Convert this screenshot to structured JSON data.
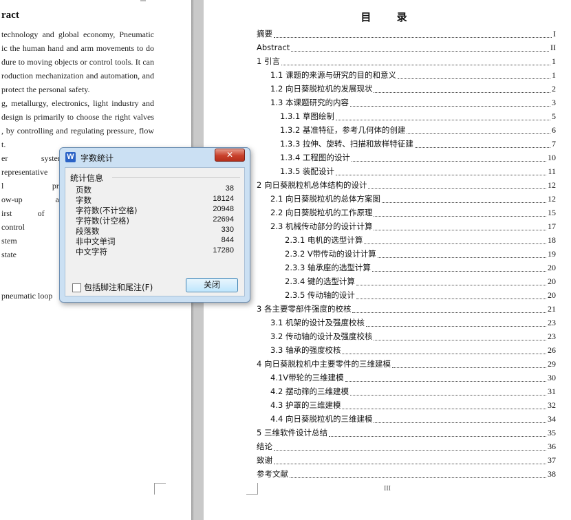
{
  "left_page": {
    "title": "ract",
    "lines": [
      "technology and global economy, Pneumatic",
      "ic the human hand and arm movements to do",
      "dure to moving objects or control tools. It can",
      "roduction mechanization and automation, and",
      "protect the personal safety.",
      "g, metallurgy, electronics, light industry and",
      "design is primarily to choose the right valves",
      ", by controlling and regulating pressure, flow",
      "t.",
      "er system, with m",
      "representative as a",
      "l process, pendulu",
      "ow-up and track, t",
      "irst of all, the mat",
      " control design to",
      "stem performance",
      " state feedback co",
      "",
      "",
      " pneumatic loop"
    ]
  },
  "toc": {
    "title": "目 录",
    "entries": [
      {
        "label": "摘要",
        "page": "I"
      },
      {
        "label": "Abstract",
        "page": "II"
      },
      {
        "label": "1   引言",
        "page": "1"
      },
      {
        "label": "1.1 课题的来源与研究的目的和意义",
        "page": "1"
      },
      {
        "label": "1.2 向日葵脱粒机的发展现状",
        "page": "2"
      },
      {
        "label": "1.3 本课题研究的内容",
        "page": "3"
      },
      {
        "label": "1.3.1 草图绘制",
        "page": "5"
      },
      {
        "label": "1.3.2 基准特征，参考几何体的创建",
        "page": "6"
      },
      {
        "label": "1.3.3 拉伸、旋转、扫描和放样特征建",
        "page": "7"
      },
      {
        "label": "1.3.4 工程图的设计",
        "page": "10"
      },
      {
        "label": "1.3.5 装配设计",
        "page": "11"
      },
      {
        "label": "2   向日葵脱粒机总体结构的设计",
        "page": "12"
      },
      {
        "label": "2.1 向日葵脱粒机的总体方案图",
        "page": "12"
      },
      {
        "label": "2.2 向日葵脱粒机的工作原理",
        "page": "15"
      },
      {
        "label": "2.3 机械传动部分的设计计算",
        "page": "17"
      },
      {
        "label": "2.3.1 电机的选型计算",
        "page": "18"
      },
      {
        "label": "2.3.2 V带传动的设计计算",
        "page": "19"
      },
      {
        "label": "2.3.3 轴承座的选型计算",
        "page": "20"
      },
      {
        "label": "2.3.4 键的选型计算",
        "page": "20"
      },
      {
        "label": "2.3.5 传动轴的设计",
        "page": "20"
      },
      {
        "label": "3   各主要零部件强度的校核",
        "page": "21"
      },
      {
        "label": "3.1 机架的设计及强度校核",
        "page": "23"
      },
      {
        "label": "3.2 传动轴的设计及强度校核",
        "page": "23"
      },
      {
        "label": "3.3 轴承的强度校核",
        "page": "26"
      },
      {
        "label": "4   向日葵脱粒机中主要零件的三维建模",
        "page": "29"
      },
      {
        "label": "4.1V带轮的三维建模",
        "page": "30"
      },
      {
        "label": "4.2 摆动筛的三维建模",
        "page": "31"
      },
      {
        "label": "4.3 护罩的三维建模",
        "page": "32"
      },
      {
        "label": "4.4 向日葵脱粒机的三维建模",
        "page": "34"
      },
      {
        "label": "5   三维软件设计总结",
        "page": "35"
      },
      {
        "label": "结论",
        "page": "36"
      },
      {
        "label": "致谢",
        "page": "37"
      },
      {
        "label": "参考文献",
        "page": "38"
      }
    ],
    "footer": "III"
  },
  "dialog": {
    "icon_letter": "W",
    "title": "字数统计",
    "close_glyph": "✕",
    "group_label": "统计信息",
    "stats": [
      {
        "key": "页数",
        "value": "38"
      },
      {
        "key": "字数",
        "value": "18124"
      },
      {
        "key": "字符数(不计空格)",
        "value": "20948"
      },
      {
        "key": "字符数(计空格)",
        "value": "22694"
      },
      {
        "key": "段落数",
        "value": "330"
      },
      {
        "key": "非中文单词",
        "value": "844"
      },
      {
        "key": "中文字符",
        "value": "17280"
      }
    ],
    "checkbox_label": "包括脚注和尾注(F)",
    "checkbox_checked": false,
    "close_button": "关闭"
  }
}
